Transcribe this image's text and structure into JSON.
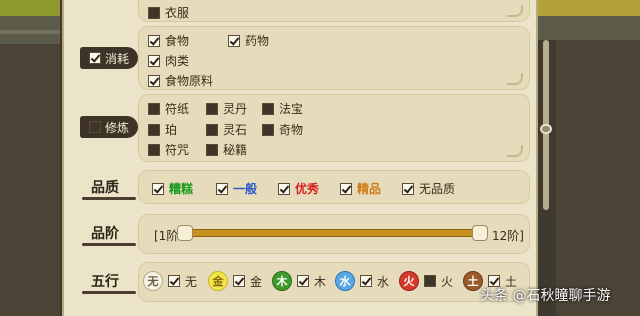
{
  "categories": {
    "clothing": {
      "label": "衣服",
      "checked": false
    },
    "consumables": {
      "label": "消耗",
      "checked": true,
      "items": [
        {
          "label": "食物",
          "checked": true
        },
        {
          "label": "药物",
          "checked": true
        },
        {
          "label": "肉类",
          "checked": true
        },
        {
          "label": "食物原料",
          "checked": true
        }
      ]
    },
    "cultivation": {
      "label": "修炼",
      "checked": false,
      "items": [
        {
          "label": "符纸",
          "checked": false
        },
        {
          "label": "灵丹",
          "checked": false
        },
        {
          "label": "法宝",
          "checked": false
        },
        {
          "label": "珀",
          "checked": false
        },
        {
          "label": "灵石",
          "checked": false
        },
        {
          "label": "奇物",
          "checked": false
        },
        {
          "label": "符咒",
          "checked": false
        },
        {
          "label": "秘籍",
          "checked": false
        }
      ]
    }
  },
  "quality": {
    "label": "品质",
    "options": [
      {
        "label": "糟糕",
        "checked": true,
        "color": "#1a9a1a"
      },
      {
        "label": "一般",
        "checked": true,
        "color": "#2a58c8"
      },
      {
        "label": "优秀",
        "checked": true,
        "color": "#d81f1f"
      },
      {
        "label": "精品",
        "checked": true,
        "color": "#d07a16"
      },
      {
        "label": "无品质",
        "checked": true,
        "color": "#3a2d1a"
      }
    ]
  },
  "tier": {
    "label": "品阶",
    "min_label": "[1阶",
    "max_label": "12阶]",
    "min": 1,
    "max": 12
  },
  "elements": {
    "label": "五行",
    "options": [
      {
        "glyph": "无",
        "label": "无",
        "checked": true,
        "icon": "element-none-icon"
      },
      {
        "glyph": "金",
        "label": "金",
        "checked": true,
        "icon": "element-gold-icon"
      },
      {
        "glyph": "木",
        "label": "木",
        "checked": true,
        "icon": "element-wood-icon"
      },
      {
        "glyph": "水",
        "label": "水",
        "checked": true,
        "icon": "element-water-icon"
      },
      {
        "glyph": "火",
        "label": "火",
        "checked": false,
        "icon": "element-fire-icon"
      },
      {
        "glyph": "土",
        "label": "土",
        "checked": true,
        "icon": "element-earth-icon"
      }
    ]
  },
  "watermark": "头条 @石秋瞳聊手游"
}
